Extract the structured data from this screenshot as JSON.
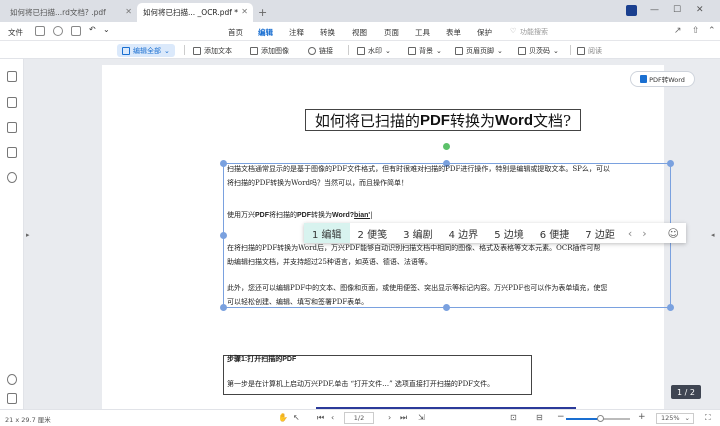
{
  "window": {
    "tabs": [
      {
        "label": "如何将已扫描...rd文档? .pdf",
        "active": false
      },
      {
        "label": "如何将已扫描... _OCR.pdf *",
        "active": true
      }
    ],
    "new_tab": "+",
    "controls": [
      "—",
      "☐",
      "✕"
    ]
  },
  "menubar": {
    "file_label": "文件",
    "tabs": [
      {
        "label": "首页",
        "active": false
      },
      {
        "label": "编辑",
        "active": true
      },
      {
        "label": "注释",
        "active": false
      },
      {
        "label": "转换",
        "active": false
      },
      {
        "label": "视图",
        "active": false
      },
      {
        "label": "页面",
        "active": false
      },
      {
        "label": "工具",
        "active": false
      },
      {
        "label": "表单",
        "active": false
      },
      {
        "label": "保护",
        "active": false
      }
    ],
    "search_hint": "功能搜索"
  },
  "toolbar": {
    "edit_all": "编辑全部",
    "add_text": "添加文本",
    "add_image": "添加图像",
    "link": "链接",
    "watermark": "水印",
    "background": "背景",
    "header_footer": "页眉页脚",
    "bates": "贝茨码",
    "read": "阅读"
  },
  "document": {
    "title_prefix": "如何将已扫描的",
    "title_pdf": "PDF",
    "title_mid": "转换为",
    "title_word": "Word",
    "title_suffix": "文档?",
    "para1_line1": "扫描文档通常显示的是基于图像的PDF文件格式，但有时很难对扫描的PDF进行操作，特别是编辑或提取文本。SP么，可以",
    "para1_line2": "将扫描的PDF转换为Word吗？当然可以，而且操作简单！",
    "para2_prefix": "使用万兴",
    "para2_pdf": "PDF",
    "para2_mid": "将扫描的",
    "para2_pdf2": "PDF",
    "para2_conv": "转换为",
    "para2_word": "Word?",
    "para2_typing": "bian'",
    "para3_line1": "在将扫描的PDF转换为Word后，万兴PDF能够自动识别扫描文档中相同的图像、格式及表格等文本元素。OCR插件可帮",
    "para3_line2": "助编辑扫描文档，并支持超过25种语言，如英语、德语、法语等。",
    "para4_line1": "此外，您还可以编辑PDF中的文本、图像和页面，或使用便签、突出显示等标记内容。万兴PDF也可以作为表单填充，使您",
    "para4_line2": "可以轻松创建、编辑、填写和签署PDF表单。",
    "step_title": "步骤1:打开扫描的PDF",
    "step_body": "第一步是在计算机上启动万兴PDF,单击 “打开文件…” 选项直接打开扫描的PDF文件。"
  },
  "ime": {
    "candidates": [
      {
        "label": "1 编辑",
        "selected": true
      },
      {
        "label": "2 便笺",
        "selected": false
      },
      {
        "label": "3 编剧",
        "selected": false
      },
      {
        "label": "4 边界",
        "selected": false
      },
      {
        "label": "5 边境",
        "selected": false
      },
      {
        "label": "6 便捷",
        "selected": false
      },
      {
        "label": "7 边距",
        "selected": false
      }
    ],
    "prev": "‹",
    "next": "›",
    "emoji": "☺"
  },
  "pdf_to_word": "PDF转Word",
  "page_indicator": "1 / 2",
  "statusbar": {
    "page_size": "21 x 29.7 厘米",
    "page_input": "1/2",
    "zoom": "125%",
    "zoom_level": 0.55
  }
}
